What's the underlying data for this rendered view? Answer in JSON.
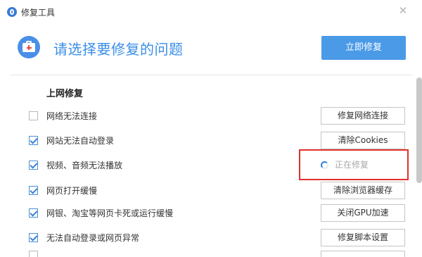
{
  "window": {
    "title": "修复工具",
    "close_icon": "close-icon",
    "app_icon": "repair-tool-logo-icon"
  },
  "header": {
    "icon": "first-aid-kit-icon",
    "title": "请选择要修复的问题",
    "primary_button": "立即修复"
  },
  "section": {
    "title": "上网修复"
  },
  "rows": [
    {
      "label": "网络无法连接",
      "checked": false,
      "action": "修复网络连接"
    },
    {
      "label": "网站无法自动登录",
      "checked": true,
      "action": "清除Cookies"
    },
    {
      "label": "视频、音频无法播放",
      "checked": true,
      "status": "正在修复"
    },
    {
      "label": "网页打开缓慢",
      "checked": true,
      "action": "清除浏览器缓存"
    },
    {
      "label": "网银、淘宝等网页卡死或运行缓慢",
      "checked": true,
      "action": "关闭GPU加速"
    },
    {
      "label": "无法自动登录或网页异常",
      "checked": true,
      "action": "修复脚本设置"
    }
  ],
  "colors": {
    "accent": "#4a9ae8",
    "title_blue": "#3a8ee6",
    "highlight": "#e2302b"
  }
}
